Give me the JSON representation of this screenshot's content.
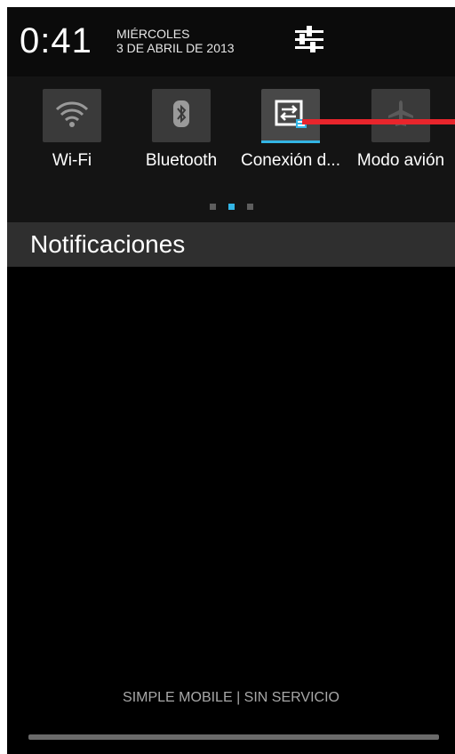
{
  "status": {
    "time": "0:41",
    "day": "MIÉRCOLES",
    "date": "3 DE ABRIL DE 2013"
  },
  "quick_settings": {
    "tiles": [
      {
        "label": "Wi-Fi",
        "icon": "wifi-icon",
        "active": false
      },
      {
        "label": "Bluetooth",
        "icon": "bluetooth-icon",
        "active": false
      },
      {
        "label": "Conexión d...",
        "icon": "tethering-icon",
        "active": true
      },
      {
        "label": "Modo avión",
        "icon": "airplane-icon",
        "active": false
      }
    ],
    "page_count": 3,
    "current_page": 2
  },
  "notifications": {
    "title": "Notificaciones"
  },
  "carrier": "SIMPLE MOBILE | SIN SERVICIO",
  "colors": {
    "accent": "#33b5e5",
    "annotation_arrow": "#e8252c",
    "background": "#000000"
  }
}
